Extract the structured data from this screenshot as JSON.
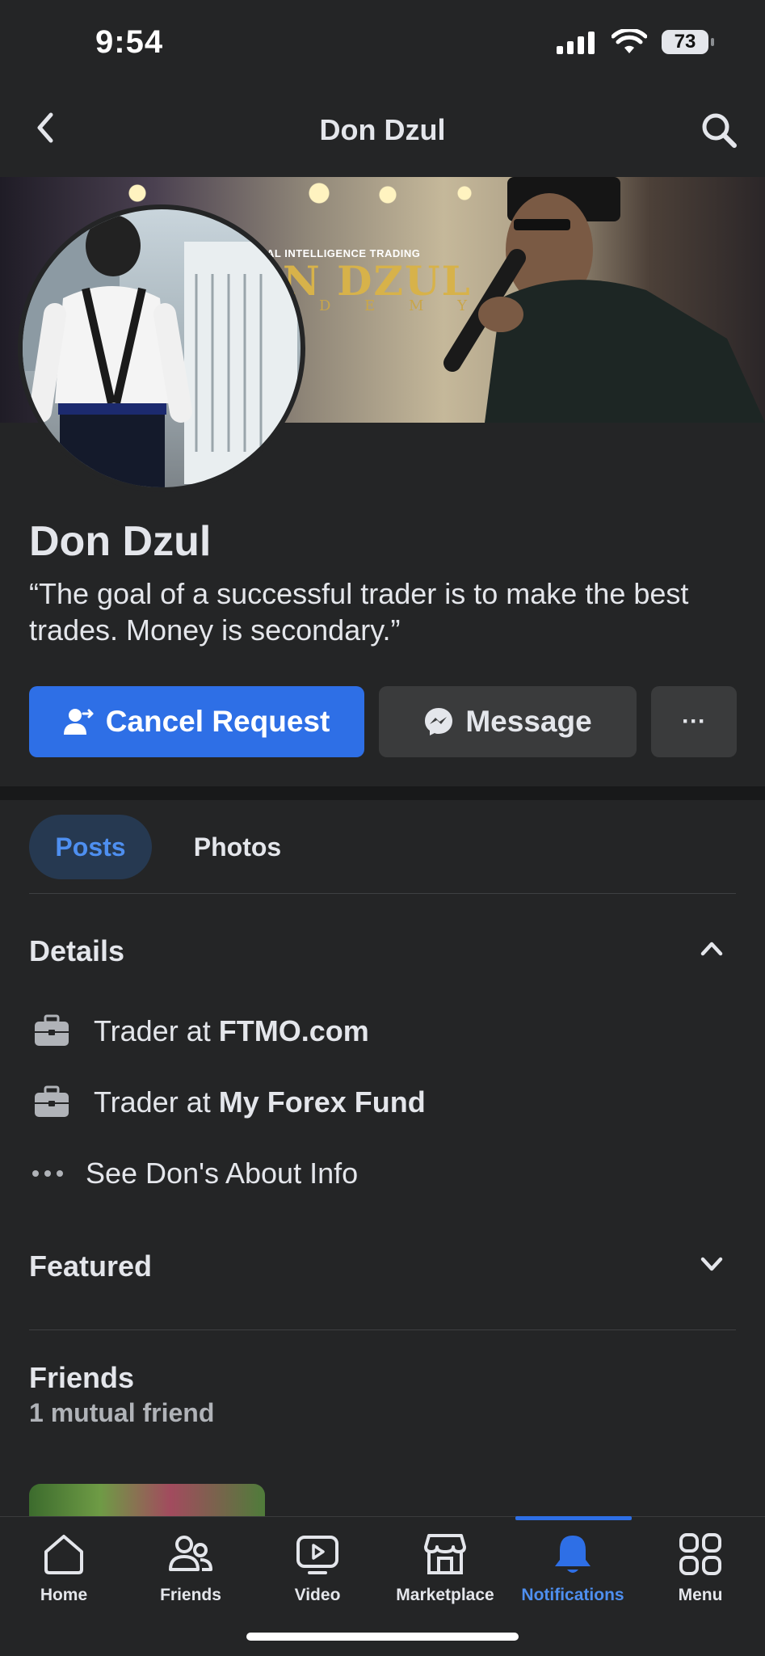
{
  "status_bar": {
    "time": "9:54",
    "battery": "73"
  },
  "header": {
    "title": "Don Dzul"
  },
  "cover": {
    "logo_small": "AL INTELLIGENCE TRADING",
    "logo_big": "N DZUL",
    "logo_sub": "D E M Y"
  },
  "profile": {
    "name": "Don Dzul",
    "bio": "“The goal of a successful trader is to make the best trades. Money is secondary.”"
  },
  "actions": {
    "cancel_request": "Cancel Request",
    "message": "Message",
    "more": "···"
  },
  "tabs": {
    "posts": "Posts",
    "photos": "Photos"
  },
  "details": {
    "title": "Details",
    "items": [
      {
        "prefix": "Trader at ",
        "bold": "FTMO.com"
      },
      {
        "prefix": "Trader at ",
        "bold": "My Forex Fund"
      }
    ],
    "see_about": "See Don's About Info"
  },
  "featured": {
    "title": "Featured"
  },
  "friends": {
    "title": "Friends",
    "subtitle": "1 mutual friend"
  },
  "nav": {
    "items": [
      {
        "label": "Home",
        "icon": "home-icon"
      },
      {
        "label": "Friends",
        "icon": "friends-icon"
      },
      {
        "label": "Video",
        "icon": "video-icon"
      },
      {
        "label": "Marketplace",
        "icon": "marketplace-icon"
      },
      {
        "label": "Notifications",
        "icon": "bell-icon",
        "active": true
      },
      {
        "label": "Menu",
        "icon": "menu-grid-icon"
      }
    ]
  },
  "colors": {
    "accent": "#2e6fe6",
    "background": "#242526",
    "button_secondary": "#3a3b3c"
  }
}
